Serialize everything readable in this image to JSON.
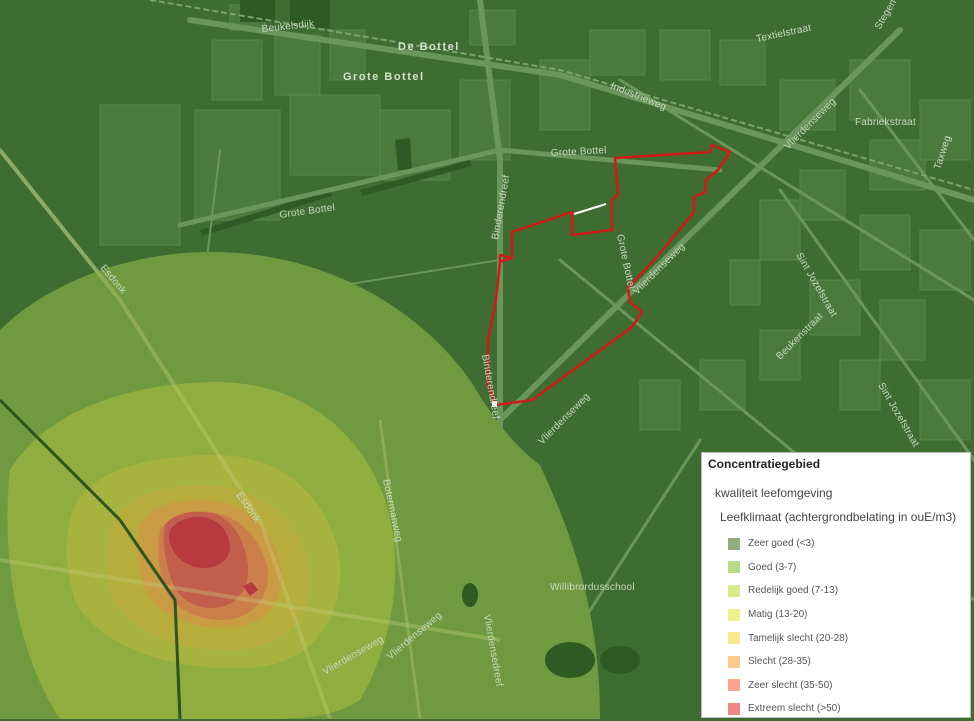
{
  "streets": {
    "beukelsdijk": "Beukelsdijk",
    "de_bottel": "De Bottel",
    "grote_bottel_top": "Grote Bottel",
    "grote_bottel_mid": "Grote Bottel",
    "grote_bottel_low": "Grote Bottel",
    "textielstraat": "Textielstraat",
    "industrieweg": "Industrieweg",
    "fabriekstraat": "Fabriekstraat",
    "vlierdenseweg_ne": "Vlierdenseweg",
    "taxweg": "Taxweg",
    "binderendreef_top": "Binderendreef",
    "binderendreef_low": "Binderendreef",
    "grote_bottel_vert": "Grote Bottel",
    "vlierdenseweg_mid": "Vlierdenseweg",
    "sint_jozefstraat_1": "Sint Jozefstraat",
    "sint_jozefstraat_2": "Sint Jozefstraat",
    "beukenstraat": "Beukenstraat",
    "esdonk_top": "Esdonk",
    "esdonk_mid": "Esdonk",
    "vlierdenseweg_sw": "Vlierdenseweg",
    "vlierdenseweg_s": "Vlierdenseweg",
    "vlierdensedreef": "Vlierdensedreef",
    "botermanweg": "Botermanweg",
    "willibrordusschool": "Willibrordusschool",
    "stegen": "Stegen"
  },
  "legend": {
    "title": "Concentratiegebied",
    "group": "kwaliteit leefomgeving",
    "layer": "Leefklimaat (achtergrondbelating in ouE/m3)",
    "items": [
      {
        "label": "Zeer goed (<3)",
        "color": "#8fae7c"
      },
      {
        "label": "Goed (3-7)",
        "color": "#b7db8a"
      },
      {
        "label": "Redelijk goed (7-13)",
        "color": "#d6ec8a"
      },
      {
        "label": "Matig (13-20)",
        "color": "#eef28d"
      },
      {
        "label": "Tamelijk slecht (20-28)",
        "color": "#fde88f"
      },
      {
        "label": "Slecht (28-35)",
        "color": "#fdc98c"
      },
      {
        "label": "Zeer slecht (35-50)",
        "color": "#fba68c"
      },
      {
        "label": "Extreem slecht (>50)",
        "color": "#f38687"
      }
    ]
  },
  "colors": {
    "map_background": "#3f6d31",
    "plan_outline": "#d11a1a"
  }
}
